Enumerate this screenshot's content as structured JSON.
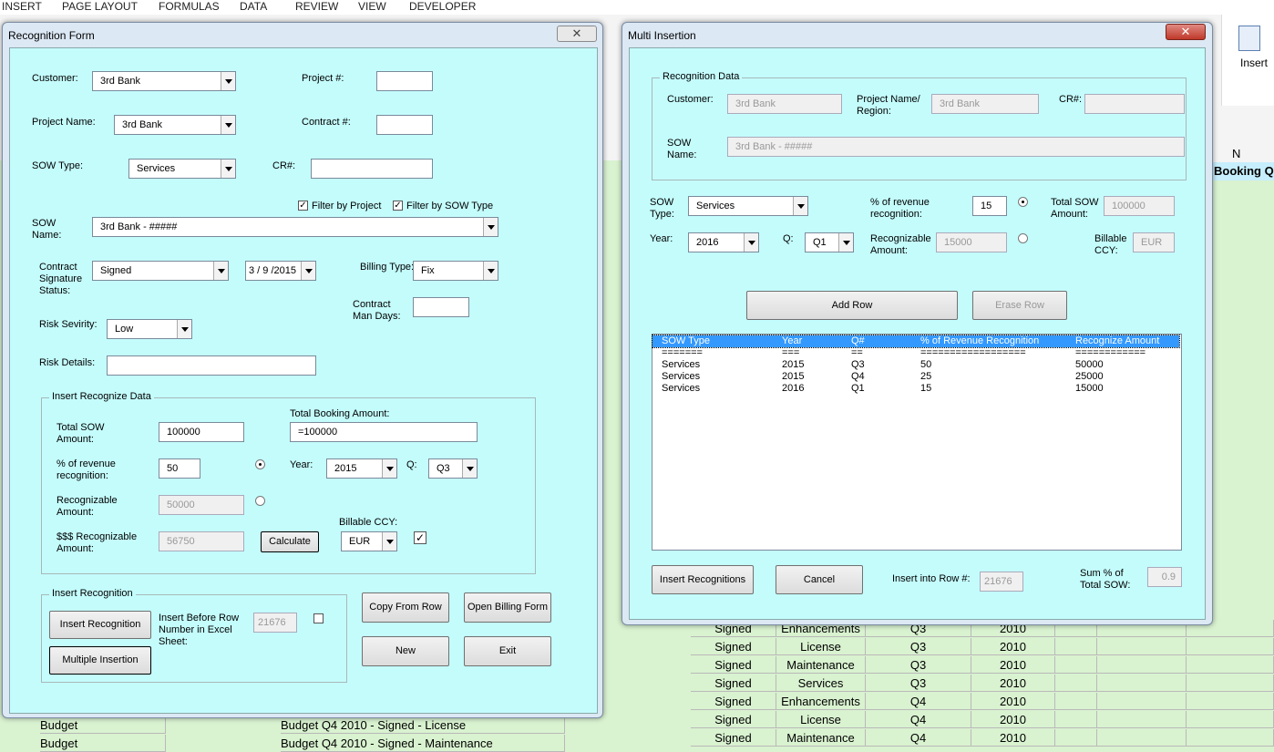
{
  "ribbon": {
    "tabs": [
      "INSERT",
      "PAGE LAYOUT",
      "FORMULAS",
      "DATA",
      "REVIEW",
      "VIEW",
      "DEVELOPER"
    ],
    "insert_label": "Insert",
    "col_n": "N",
    "booking_header": "Booking Q"
  },
  "sheet": {
    "rows": [
      {
        "status": "Signed",
        "type": "Enhancements",
        "q": "Q3",
        "year": "2010"
      },
      {
        "status": "Signed",
        "type": "License",
        "q": "Q3",
        "year": "2010"
      },
      {
        "status": "Signed",
        "type": "Maintenance",
        "q": "Q3",
        "year": "2010"
      },
      {
        "status": "Signed",
        "type": "Services",
        "q": "Q3",
        "year": "2010"
      },
      {
        "status": "Signed",
        "type": "Enhancements",
        "q": "Q4",
        "year": "2010"
      },
      {
        "status": "Signed",
        "type": "License",
        "q": "Q4",
        "year": "2010"
      },
      {
        "status": "Signed",
        "type": "Maintenance",
        "q": "Q4",
        "year": "2010"
      }
    ],
    "bottom_rows": [
      {
        "a": "Budget",
        "desc": "Budget Q4 2010 - Signed - License"
      },
      {
        "a": "Budget",
        "desc": "Budget Q4 2010 - Signed - Maintenance"
      }
    ]
  },
  "recognition_form": {
    "title": "Recognition Form",
    "close": "✕",
    "customer_label": "Customer:",
    "customer_value": "3rd Bank",
    "project_num_label": "Project #:",
    "project_name_label": "Project Name:",
    "project_name_value": "3rd Bank",
    "contract_num_label": "Contract #:",
    "sow_type_label": "SOW Type:",
    "sow_type_value": "Services",
    "cr_label": "CR#:",
    "filter_project_label": "Filter by Project",
    "filter_sow_label": "Filter by SOW Type",
    "sow_name_label": "SOW Name:",
    "sow_name_value": "3rd Bank - #####",
    "contract_sig_label": "Contract Signature Status:",
    "contract_sig_value": "Signed",
    "date_value": "3 / 9 /2015",
    "billing_type_label": "Billing Type:",
    "billing_type_value": "Fix",
    "contract_man_days_label": "Contract Man Days:",
    "risk_sev_label": "Risk Sevirity:",
    "risk_sev_value": "Low",
    "risk_details_label": "Risk Details:",
    "insert_data_title": "Insert Recognize Data",
    "total_sow_label": "Total SOW Amount:",
    "total_sow_value": "100000",
    "total_booking_label": "Total Booking Amount:",
    "total_booking_value": "=100000",
    "pct_label": "% of revenue recognition:",
    "pct_value": "50",
    "year_label": "Year:",
    "year_value": "2015",
    "q_label": "Q:",
    "q_value": "Q3",
    "recog_amount_label": "Recognizable Amount:",
    "recog_amount_value": "50000",
    "usd_recog_label": "$$$ Recognizable Amount:",
    "usd_recog_value": "56750",
    "calculate_label": "Calculate",
    "billable_ccy_label": "Billable CCY:",
    "billable_ccy_value": "EUR",
    "insert_recognition_title": "Insert Recognition",
    "insert_recognition_btn": "Insert Recognition",
    "insert_before_label": "Insert Before Row Number in Excel Sheet:",
    "insert_before_value": "21676",
    "multiple_insertion_btn": "Multiple Insertion",
    "copy_from_row_btn": "Copy From Row",
    "open_billing_btn": "Open Billing Form",
    "new_btn": "New",
    "exit_btn": "Exit"
  },
  "multi_insertion": {
    "title": "Multi Insertion",
    "close": "✕",
    "recog_data_title": "Recognition Data",
    "customer_label": "Customer:",
    "customer_value": "3rd Bank",
    "project_region_label": "Project Name/ Region:",
    "project_region_value": "3rd Bank",
    "cr_label": "CR#:",
    "sow_name_label": "SOW Name:",
    "sow_name_value": "3rd Bank - #####",
    "sow_type_label": "SOW Type:",
    "sow_type_value": "Services",
    "pct_label": "% of revenue recognition:",
    "pct_value": "15",
    "total_sow_label": "Total SOW Amount:",
    "total_sow_value": "100000",
    "year_label": "Year:",
    "year_value": "2016",
    "q_label": "Q:",
    "q_value": "Q1",
    "recog_amount_label": "Recognizable Amount:",
    "recog_amount_value": "15000",
    "billable_ccy_label": "Billable CCY:",
    "billable_ccy_value": "EUR",
    "add_row_btn": "Add Row",
    "erase_row_btn": "Erase Row",
    "list_headers": [
      "SOW Type",
      "Year",
      "Q#",
      "% of Revenue Recognition",
      "Recognize Amount"
    ],
    "list_separators": [
      "=======",
      "===",
      "==",
      "==================",
      "============"
    ],
    "list_rows": [
      [
        "Services",
        "2015",
        "Q3",
        "50",
        "50000"
      ],
      [
        "Services",
        "2015",
        "Q4",
        "25",
        "25000"
      ],
      [
        "Services",
        "2016",
        "Q1",
        "15",
        "15000"
      ]
    ],
    "insert_recognitions_btn": "Insert Recognitions",
    "cancel_btn": "Cancel",
    "insert_into_label": "Insert into Row #:",
    "insert_into_value": "21676",
    "sum_pct_label": "Sum % of Total SOW:",
    "sum_pct_value": "0.9"
  },
  "colors": {
    "dialog_bg": "#c4fcfc",
    "sheet_bg": "#d9f2d0",
    "selection": "#3399ff",
    "close_red": "#c8433a"
  }
}
